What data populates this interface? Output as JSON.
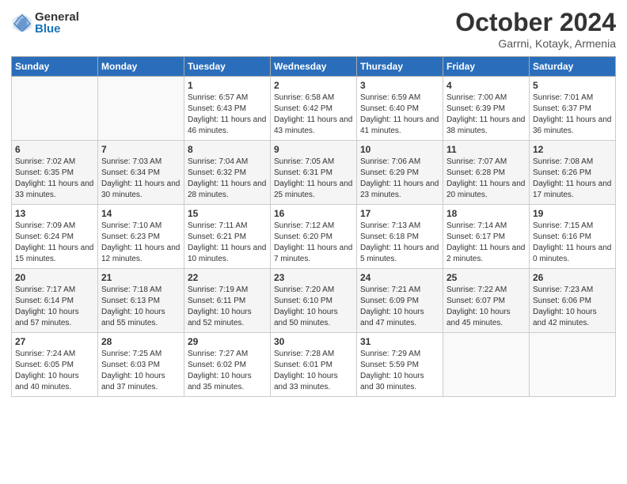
{
  "header": {
    "logo": {
      "general": "General",
      "blue": "Blue"
    },
    "title": "October 2024",
    "location": "Garrni, Kotayk, Armenia"
  },
  "weekdays": [
    "Sunday",
    "Monday",
    "Tuesday",
    "Wednesday",
    "Thursday",
    "Friday",
    "Saturday"
  ],
  "weeks": [
    [
      {
        "day": "",
        "sunrise": "",
        "sunset": "",
        "daylight": ""
      },
      {
        "day": "",
        "sunrise": "",
        "sunset": "",
        "daylight": ""
      },
      {
        "day": "1",
        "sunrise": "Sunrise: 6:57 AM",
        "sunset": "Sunset: 6:43 PM",
        "daylight": "Daylight: 11 hours and 46 minutes."
      },
      {
        "day": "2",
        "sunrise": "Sunrise: 6:58 AM",
        "sunset": "Sunset: 6:42 PM",
        "daylight": "Daylight: 11 hours and 43 minutes."
      },
      {
        "day": "3",
        "sunrise": "Sunrise: 6:59 AM",
        "sunset": "Sunset: 6:40 PM",
        "daylight": "Daylight: 11 hours and 41 minutes."
      },
      {
        "day": "4",
        "sunrise": "Sunrise: 7:00 AM",
        "sunset": "Sunset: 6:39 PM",
        "daylight": "Daylight: 11 hours and 38 minutes."
      },
      {
        "day": "5",
        "sunrise": "Sunrise: 7:01 AM",
        "sunset": "Sunset: 6:37 PM",
        "daylight": "Daylight: 11 hours and 36 minutes."
      }
    ],
    [
      {
        "day": "6",
        "sunrise": "Sunrise: 7:02 AM",
        "sunset": "Sunset: 6:35 PM",
        "daylight": "Daylight: 11 hours and 33 minutes."
      },
      {
        "day": "7",
        "sunrise": "Sunrise: 7:03 AM",
        "sunset": "Sunset: 6:34 PM",
        "daylight": "Daylight: 11 hours and 30 minutes."
      },
      {
        "day": "8",
        "sunrise": "Sunrise: 7:04 AM",
        "sunset": "Sunset: 6:32 PM",
        "daylight": "Daylight: 11 hours and 28 minutes."
      },
      {
        "day": "9",
        "sunrise": "Sunrise: 7:05 AM",
        "sunset": "Sunset: 6:31 PM",
        "daylight": "Daylight: 11 hours and 25 minutes."
      },
      {
        "day": "10",
        "sunrise": "Sunrise: 7:06 AM",
        "sunset": "Sunset: 6:29 PM",
        "daylight": "Daylight: 11 hours and 23 minutes."
      },
      {
        "day": "11",
        "sunrise": "Sunrise: 7:07 AM",
        "sunset": "Sunset: 6:28 PM",
        "daylight": "Daylight: 11 hours and 20 minutes."
      },
      {
        "day": "12",
        "sunrise": "Sunrise: 7:08 AM",
        "sunset": "Sunset: 6:26 PM",
        "daylight": "Daylight: 11 hours and 17 minutes."
      }
    ],
    [
      {
        "day": "13",
        "sunrise": "Sunrise: 7:09 AM",
        "sunset": "Sunset: 6:24 PM",
        "daylight": "Daylight: 11 hours and 15 minutes."
      },
      {
        "day": "14",
        "sunrise": "Sunrise: 7:10 AM",
        "sunset": "Sunset: 6:23 PM",
        "daylight": "Daylight: 11 hours and 12 minutes."
      },
      {
        "day": "15",
        "sunrise": "Sunrise: 7:11 AM",
        "sunset": "Sunset: 6:21 PM",
        "daylight": "Daylight: 11 hours and 10 minutes."
      },
      {
        "day": "16",
        "sunrise": "Sunrise: 7:12 AM",
        "sunset": "Sunset: 6:20 PM",
        "daylight": "Daylight: 11 hours and 7 minutes."
      },
      {
        "day": "17",
        "sunrise": "Sunrise: 7:13 AM",
        "sunset": "Sunset: 6:18 PM",
        "daylight": "Daylight: 11 hours and 5 minutes."
      },
      {
        "day": "18",
        "sunrise": "Sunrise: 7:14 AM",
        "sunset": "Sunset: 6:17 PM",
        "daylight": "Daylight: 11 hours and 2 minutes."
      },
      {
        "day": "19",
        "sunrise": "Sunrise: 7:15 AM",
        "sunset": "Sunset: 6:16 PM",
        "daylight": "Daylight: 11 hours and 0 minutes."
      }
    ],
    [
      {
        "day": "20",
        "sunrise": "Sunrise: 7:17 AM",
        "sunset": "Sunset: 6:14 PM",
        "daylight": "Daylight: 10 hours and 57 minutes."
      },
      {
        "day": "21",
        "sunrise": "Sunrise: 7:18 AM",
        "sunset": "Sunset: 6:13 PM",
        "daylight": "Daylight: 10 hours and 55 minutes."
      },
      {
        "day": "22",
        "sunrise": "Sunrise: 7:19 AM",
        "sunset": "Sunset: 6:11 PM",
        "daylight": "Daylight: 10 hours and 52 minutes."
      },
      {
        "day": "23",
        "sunrise": "Sunrise: 7:20 AM",
        "sunset": "Sunset: 6:10 PM",
        "daylight": "Daylight: 10 hours and 50 minutes."
      },
      {
        "day": "24",
        "sunrise": "Sunrise: 7:21 AM",
        "sunset": "Sunset: 6:09 PM",
        "daylight": "Daylight: 10 hours and 47 minutes."
      },
      {
        "day": "25",
        "sunrise": "Sunrise: 7:22 AM",
        "sunset": "Sunset: 6:07 PM",
        "daylight": "Daylight: 10 hours and 45 minutes."
      },
      {
        "day": "26",
        "sunrise": "Sunrise: 7:23 AM",
        "sunset": "Sunset: 6:06 PM",
        "daylight": "Daylight: 10 hours and 42 minutes."
      }
    ],
    [
      {
        "day": "27",
        "sunrise": "Sunrise: 7:24 AM",
        "sunset": "Sunset: 6:05 PM",
        "daylight": "Daylight: 10 hours and 40 minutes."
      },
      {
        "day": "28",
        "sunrise": "Sunrise: 7:25 AM",
        "sunset": "Sunset: 6:03 PM",
        "daylight": "Daylight: 10 hours and 37 minutes."
      },
      {
        "day": "29",
        "sunrise": "Sunrise: 7:27 AM",
        "sunset": "Sunset: 6:02 PM",
        "daylight": "Daylight: 10 hours and 35 minutes."
      },
      {
        "day": "30",
        "sunrise": "Sunrise: 7:28 AM",
        "sunset": "Sunset: 6:01 PM",
        "daylight": "Daylight: 10 hours and 33 minutes."
      },
      {
        "day": "31",
        "sunrise": "Sunrise: 7:29 AM",
        "sunset": "Sunset: 5:59 PM",
        "daylight": "Daylight: 10 hours and 30 minutes."
      },
      {
        "day": "",
        "sunrise": "",
        "sunset": "",
        "daylight": ""
      },
      {
        "day": "",
        "sunrise": "",
        "sunset": "",
        "daylight": ""
      }
    ]
  ]
}
